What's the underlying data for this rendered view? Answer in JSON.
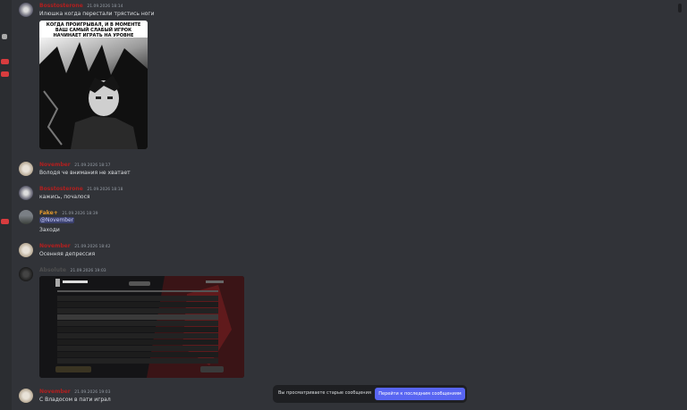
{
  "colors": {
    "background": "#313338",
    "author_red": "#b21f1f",
    "author_orange": "#e39a2e",
    "author_dark": "#4f4f4f",
    "accent": "#5865f2",
    "mention_bg": "#3c4270"
  },
  "messages": [
    {
      "author": "Bosstosterone",
      "timestamp": "21.09.2026 18:14",
      "text": "Илюшка когда перестали трястись ноги",
      "attachment": {
        "caption": "КОГДА ПРОИГРЫВАЛ, И В МОМЕНТЕ ВАШ САМЫЙ СЛАБЫЙ ИГРОК НАЧИНАЕТ ИГРАТЬ НА УРОВНЕ СИЛЬНЕЙШИХ."
      }
    },
    {
      "author": "November",
      "timestamp": "21.09.2026 18:17",
      "text": "Володя че внимания не хватает"
    },
    {
      "author": "Bosstosterone",
      "timestamp": "21.09.2026 18:18",
      "text": "кажись, почалося"
    },
    {
      "author": "Fake+",
      "timestamp": "21.09.2026 18:39",
      "mention": "@November",
      "text": "Заходи"
    },
    {
      "author": "November",
      "timestamp": "21.09.2026 18:42",
      "text": "Осенняя депрессия"
    },
    {
      "author": "Absolute",
      "timestamp": "21.09.2026 19:03",
      "attachment": {
        "type": "game-screenshot"
      }
    },
    {
      "author": "November",
      "timestamp": "21.09.2026 19:03",
      "text": "С Владосом в пати играл"
    }
  ],
  "toast": {
    "text": "Вы просматриваете старые сообщения",
    "button": "Перейти к последним сообщениям"
  }
}
